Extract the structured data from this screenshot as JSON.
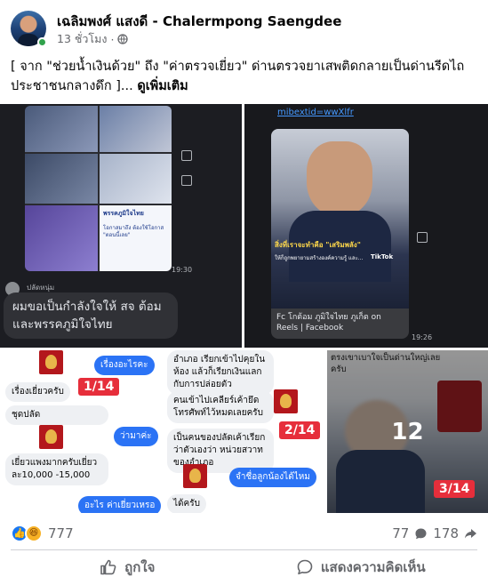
{
  "post": {
    "author": "เฉลิมพงศ์ แสงดี - Chalermpong Saengdee",
    "time": "13 ชั่วโมง",
    "dot": "·",
    "text": "[ จาก \"ช่วยน้ำเงินด้วย\" ถึง \"ค่าตรวจเยี่ยว\" ด่านตรวจยาเสพติดกลายเป็นด่านรีดไถประชาชนกลางดึก ]...",
    "see_more": "ดูเพิ่มเติม",
    "icons": {
      "avatar": "avatar",
      "privacy": "globe-icon",
      "menu": "more-icon"
    }
  },
  "media": {
    "tile1": {
      "poster_title": "พรรคภูมิใจไทย",
      "poster_lines": "โอกาสมาถึง ต้องใช้โอกาส \"ตอนนี้เลย\"",
      "time1": "19:30",
      "sender": "ปลัดหนุ่ม",
      "message": "ผมขอเป็นกำลังใจให้ สจ ต้อม และพรรคภูมิใจไทย"
    },
    "tile2": {
      "link_text": "mibextid=wwXlfr",
      "video_caption": "สิ่งที่เราจะทำคือ \"เสริมพลัง\"",
      "video_sub": "ให้ก็ถูกพยายามสร้างองค์ความรู้ และ...",
      "tiktok": "TikTok",
      "card_title": "Fc โกต้อม ภูมิใจไทย ภูเก็ต on Reels | Facebook",
      "time": "19:26"
    },
    "tile3": {
      "b1": "เรื่องอะไรคะ",
      "b2": "เรื่องเยี่ยวครับ",
      "b3": "ชุดปลัด",
      "b4": "ว่ามาค่ะ",
      "b5": "เยี่ยวแพงมากครับเยี่ยวละ10,000 -15,000",
      "b6": "อะไร ค่าเยี่ยวเหรอ",
      "counter": "1/14"
    },
    "tile4": {
      "g1": "อำเภอ เรียกเข้าไปคุยในห้อง แล้วก็เรียกเงินแลกกับการปล่อยตัว",
      "g2": "คนเข้าไปเคลียร์เค้ายึดโทรศัพท์ไว้หมดเลยครับ",
      "g3": "เป็นคนของปลัดเค้าเรียกว่าตัวเองว่า หน่วยสวาทของอำเภอ",
      "b1": "จำชื่อลูกน้องได้ไหม",
      "g4": "ได้ครับ",
      "counter": "2/14"
    },
    "tile5": {
      "top_text": "ตรงเขาเบาใจเป็นด่านใหญ่เลยครับ",
      "counter": "3/14",
      "more": "12"
    }
  },
  "reactions": {
    "count": "777",
    "comments": "77",
    "shares": "178",
    "like_icon": "like-reaction-icon",
    "haha_icon": "haha-reaction-icon"
  },
  "actions": {
    "like": "ถูกใจ",
    "comment": "แสดงความคิดเห็น"
  }
}
